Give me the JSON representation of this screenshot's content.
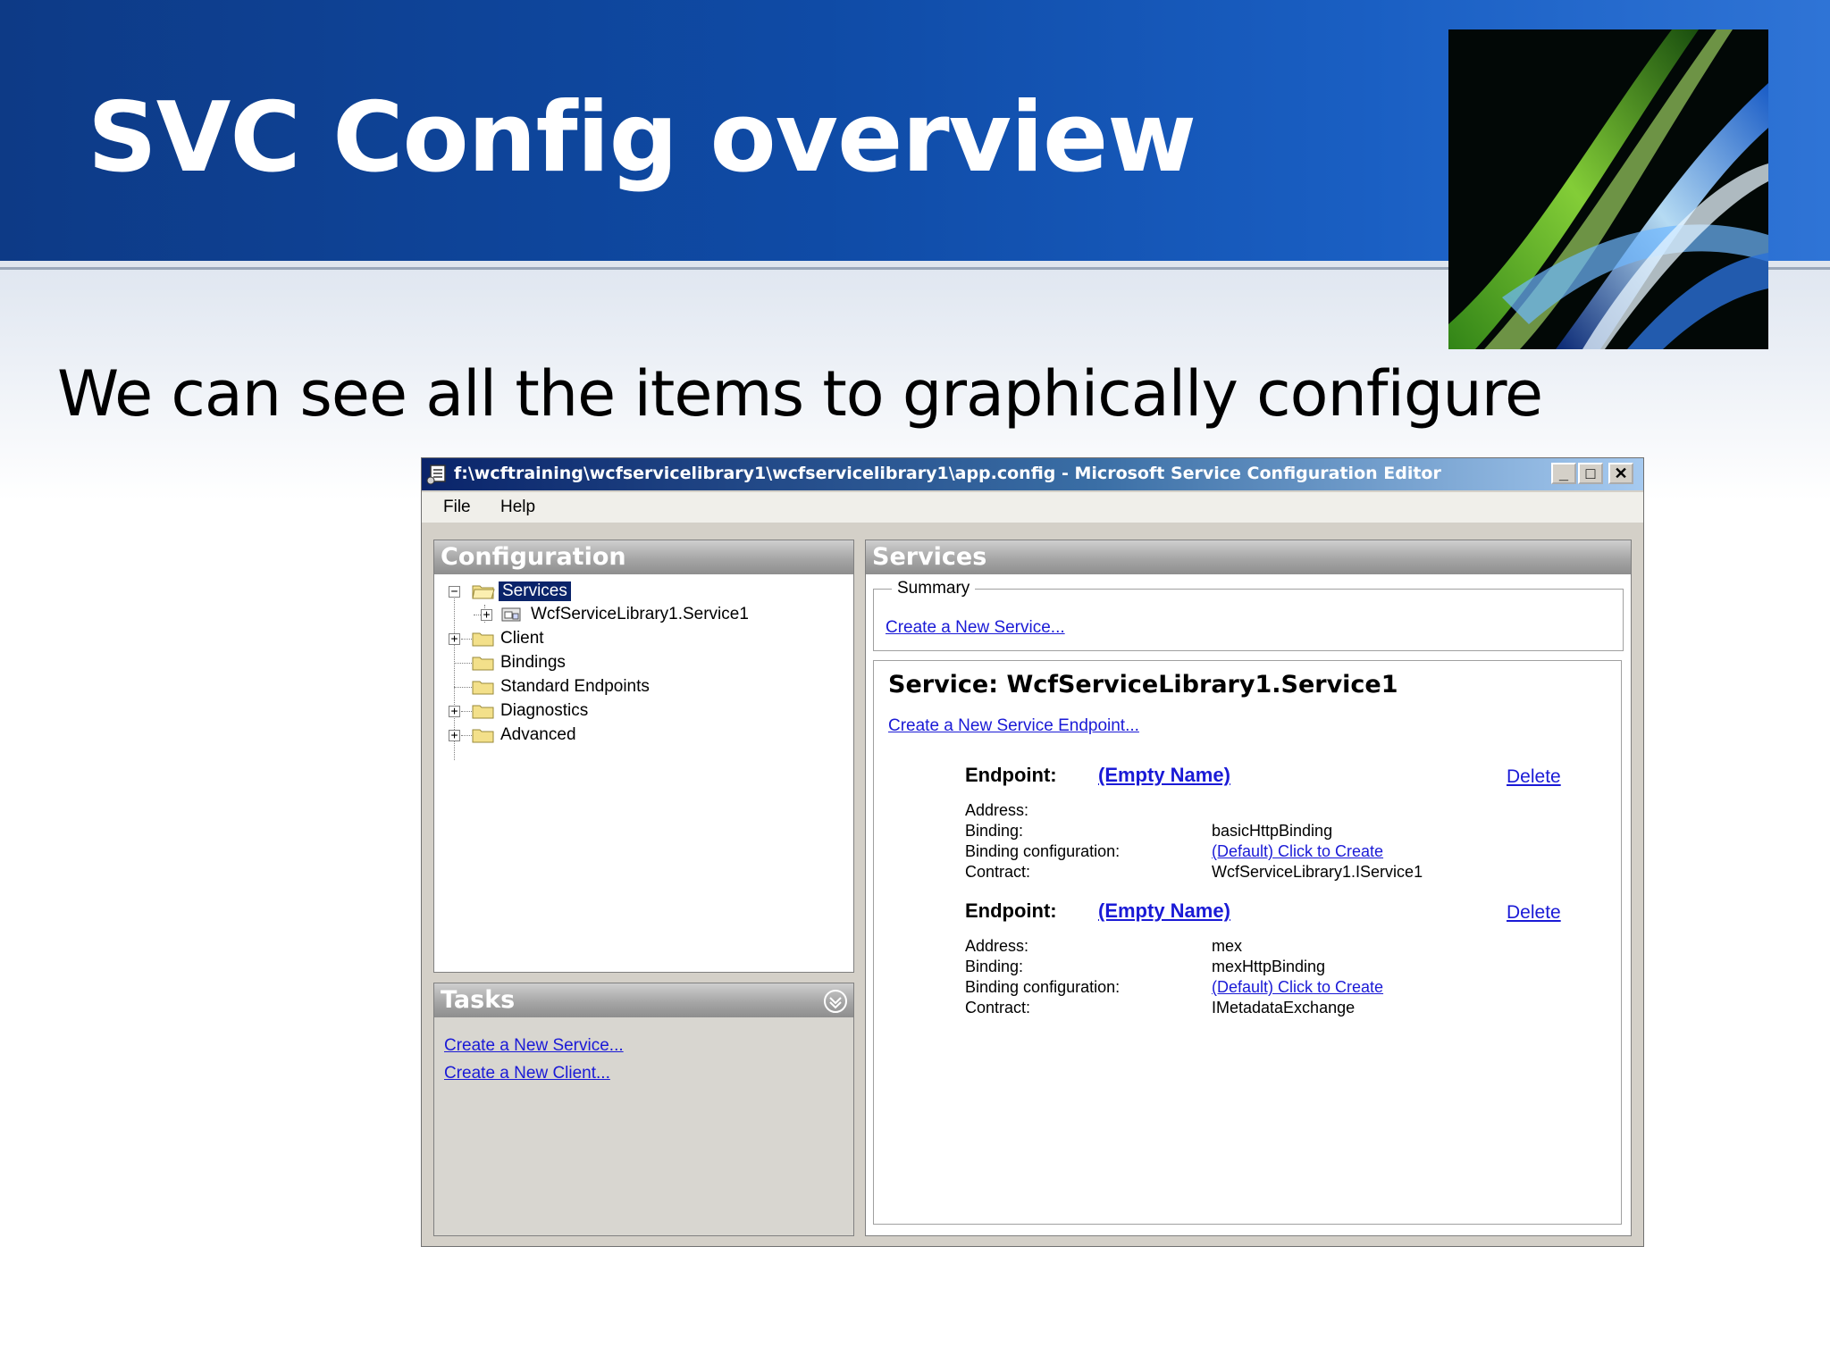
{
  "slide": {
    "title": "SVC Config overview",
    "subtitle": "We can see all the items to graphically configure"
  },
  "window": {
    "title": "f:\\wcftraining\\wcfservicelibrary1\\wcfservicelibrary1\\app.config - Microsoft Service Configuration Editor",
    "controls": {
      "minimize": "_",
      "maximize": "□",
      "close": "✕"
    },
    "menu": [
      "File",
      "Help"
    ]
  },
  "configuration": {
    "header": "Configuration",
    "tree": {
      "services": "Services",
      "service_child": "WcfServiceLibrary1.Service1",
      "client": "Client",
      "bindings": "Bindings",
      "standard_endpoints": "Standard Endpoints",
      "diagnostics": "Diagnostics",
      "advanced": "Advanced"
    }
  },
  "tasks": {
    "header": "Tasks",
    "links": [
      "Create a New Service...",
      "Create a New Client..."
    ]
  },
  "services_panel": {
    "header": "Services",
    "summary_legend": "Summary",
    "create_service_link": "Create a New Service...",
    "service_heading": "Service: WcfServiceLibrary1.Service1",
    "create_endpoint_link": "Create a New Service Endpoint...",
    "endpoint_label": "Endpoint:",
    "delete_label": "Delete",
    "prop_labels": {
      "address": "Address:",
      "binding": "Binding:",
      "binding_configuration": "Binding configuration:",
      "contract": "Contract:"
    },
    "endpoints": [
      {
        "name": "(Empty Name)",
        "address": "",
        "binding": "basicHttpBinding",
        "binding_configuration": "(Default) Click to Create",
        "contract": "WcfServiceLibrary1.IService1"
      },
      {
        "name": "(Empty Name)",
        "address": "mex",
        "binding": "mexHttpBinding",
        "binding_configuration": "(Default) Click to Create",
        "contract": "IMetadataExchange"
      }
    ]
  },
  "icons": [
    "app-config-icon",
    "folder-icon",
    "service-node-icon",
    "collapse-tasks-icon"
  ]
}
